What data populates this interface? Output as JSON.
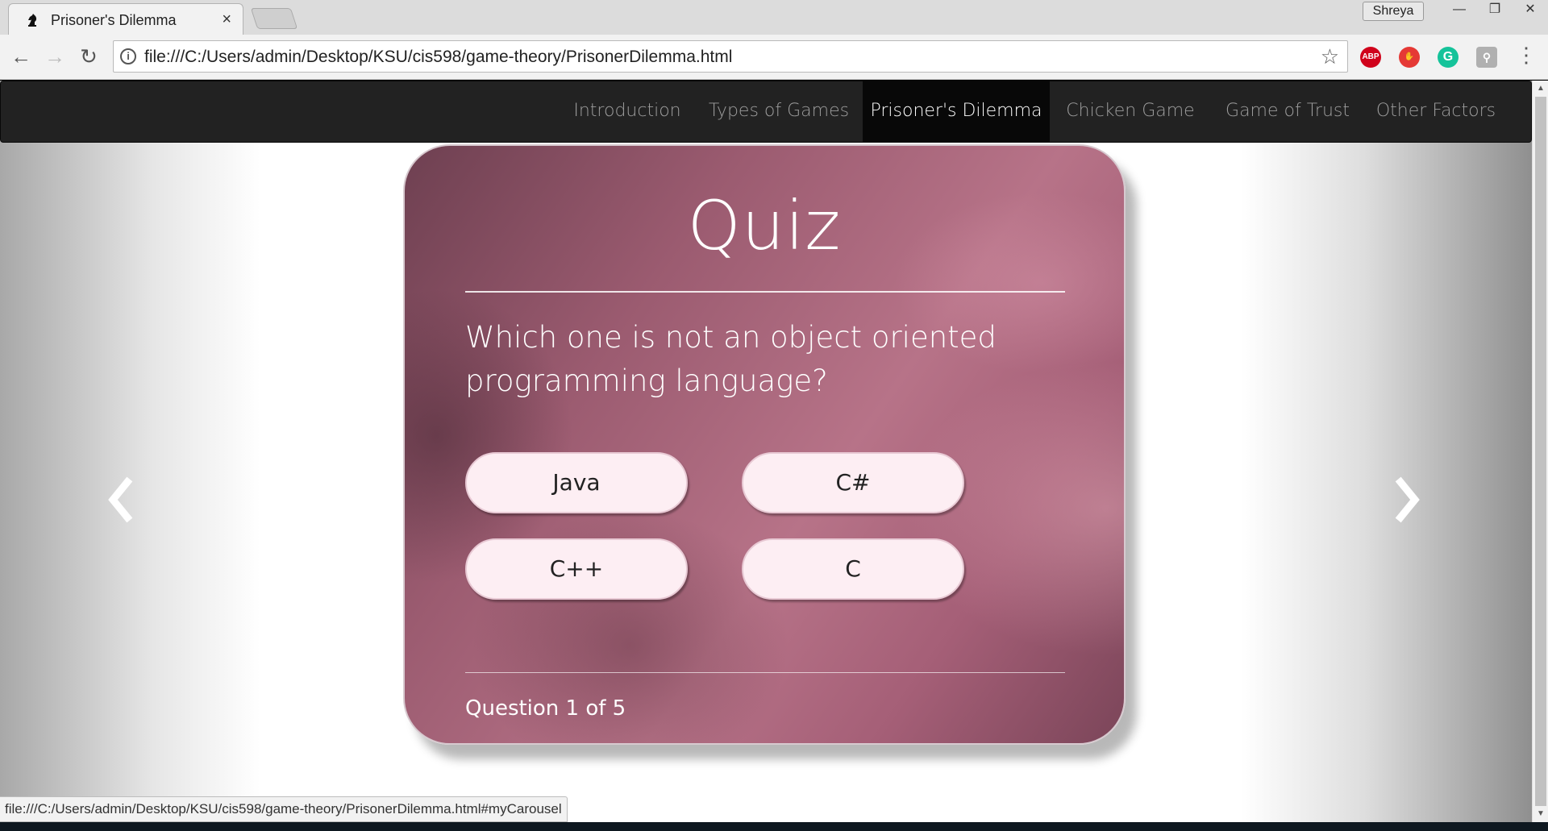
{
  "browser": {
    "tab_title": "Prisoner's Dilemma",
    "tab_close": "×",
    "profile_name": "Shreya",
    "window_controls": {
      "minimize": "—",
      "restore": "❐",
      "close": "✕"
    },
    "back": "←",
    "forward": "→",
    "reload": "↻",
    "url": "file:///C:/Users/admin/Desktop/KSU/cis598/game-theory/PrisonerDilemma.html",
    "info_icon": "i",
    "bookmark_star": "☆",
    "extensions": [
      {
        "name": "adblock-plus-icon",
        "label": "ABP",
        "color": "#d0021b"
      },
      {
        "name": "hand-stop-extension-icon",
        "label": "✋",
        "color": "#e53935"
      },
      {
        "name": "grammarly-icon",
        "label": "G",
        "color": "#15c39a"
      },
      {
        "name": "puzzle-extension-icon",
        "label": "⚲",
        "color": "#b0b0b0"
      }
    ],
    "menu": "⋮",
    "status_url": "file:///C:/Users/admin/Desktop/KSU/cis598/game-theory/PrisonerDilemma.html#myCarousel"
  },
  "nav": {
    "items": [
      {
        "label": "Introduction",
        "active": false
      },
      {
        "label": "Types of Games",
        "active": false
      },
      {
        "label": "Prisoner's Dilemma",
        "active": true
      },
      {
        "label": "Chicken Game",
        "active": false
      },
      {
        "label": "Game of Trust",
        "active": false
      },
      {
        "label": "Other Factors",
        "active": false
      }
    ],
    "background": "#222222",
    "active_background": "#080808"
  },
  "quiz": {
    "title": "Quiz",
    "question": "Which one is not an object oriented programming language?",
    "answers": [
      "Java",
      "C#",
      "C++",
      "C"
    ],
    "progress": "Question 1 of 5"
  },
  "carousel": {
    "prev_icon": "chevron-left-icon",
    "next_icon": "chevron-right-icon"
  },
  "colors": {
    "card_accent": "#a55f77",
    "answer_bg": "#fdeef3"
  }
}
